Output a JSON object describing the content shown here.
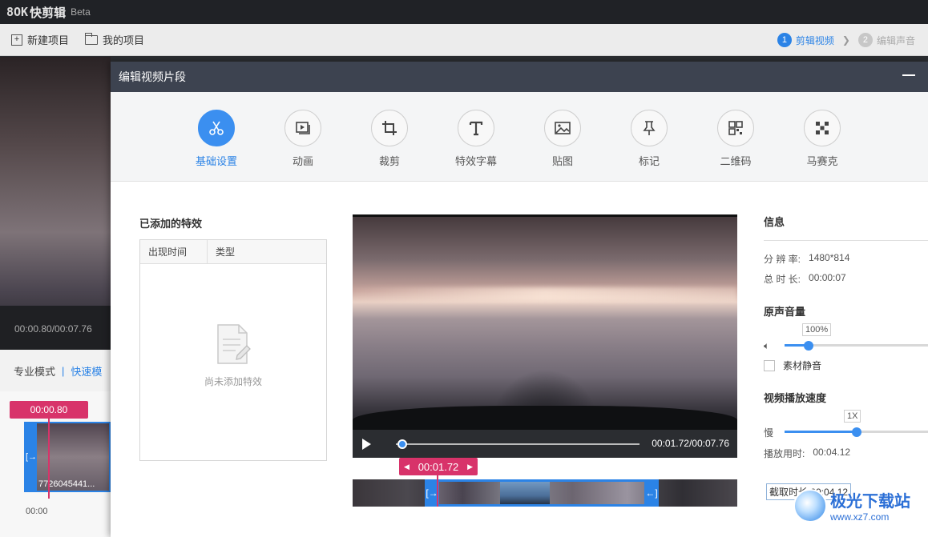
{
  "app": {
    "logo_mark": "8OK",
    "name": "快剪辑",
    "beta": "Beta"
  },
  "toolbar": {
    "new_project": "新建项目",
    "my_projects": "我的项目",
    "steps": [
      {
        "num": "1",
        "label": "剪辑视频",
        "state": "active"
      },
      {
        "num": "2",
        "label": "编辑声音",
        "state": "inactive"
      }
    ]
  },
  "background": {
    "preview_time": "00:00.80/00:07.76",
    "mode_pro": "专业模式",
    "mode_sep": "|",
    "mode_fast": "快速模",
    "marker_time": "00:00.80",
    "clip_name": "7726045441...",
    "timeline_zero": "00:00"
  },
  "dialog": {
    "title": "编辑视频片段",
    "tools": [
      {
        "label": "基础设置",
        "icon": "scissors-icon",
        "active": true
      },
      {
        "label": "动画",
        "icon": "animation-icon",
        "active": false
      },
      {
        "label": "裁剪",
        "icon": "crop-icon",
        "active": false
      },
      {
        "label": "特效字幕",
        "icon": "text-icon",
        "active": false
      },
      {
        "label": "贴图",
        "icon": "image-icon",
        "active": false
      },
      {
        "label": "标记",
        "icon": "pin-icon",
        "active": false
      },
      {
        "label": "二维码",
        "icon": "qrcode-icon",
        "active": false
      },
      {
        "label": "马赛克",
        "icon": "mosaic-icon",
        "active": false
      }
    ],
    "effects": {
      "title": "已添加的特效",
      "col_time": "出现时间",
      "col_type": "类型",
      "empty_text": "尚未添加特效"
    },
    "player": {
      "time": "00:01.72/00:07.76",
      "progress": 0.02
    },
    "trim": {
      "marker_time": "00:01.72"
    },
    "info": {
      "title": "信息",
      "resolution_label": "分 辨 率:",
      "resolution_value": "1480*814",
      "duration_label": "总 时 长:",
      "duration_value": "00:00:07",
      "volume_title": "原声音量",
      "volume_value": "100%",
      "volume_level": 0.17,
      "mute_label": "素材静音",
      "speed_title": "视频播放速度",
      "speed_value": "1X",
      "speed_level": 0.5,
      "slow_label": "慢",
      "play_time_label": "播放用时:",
      "play_time_value": "00:04.12",
      "cut_duration": "截取时长:00:04.12"
    }
  },
  "watermark": {
    "name": "极光下载站",
    "url": "www.xz7.com"
  },
  "colors": {
    "accent": "#2b83e6",
    "marker": "#d8336a",
    "header": "#3d4350"
  }
}
